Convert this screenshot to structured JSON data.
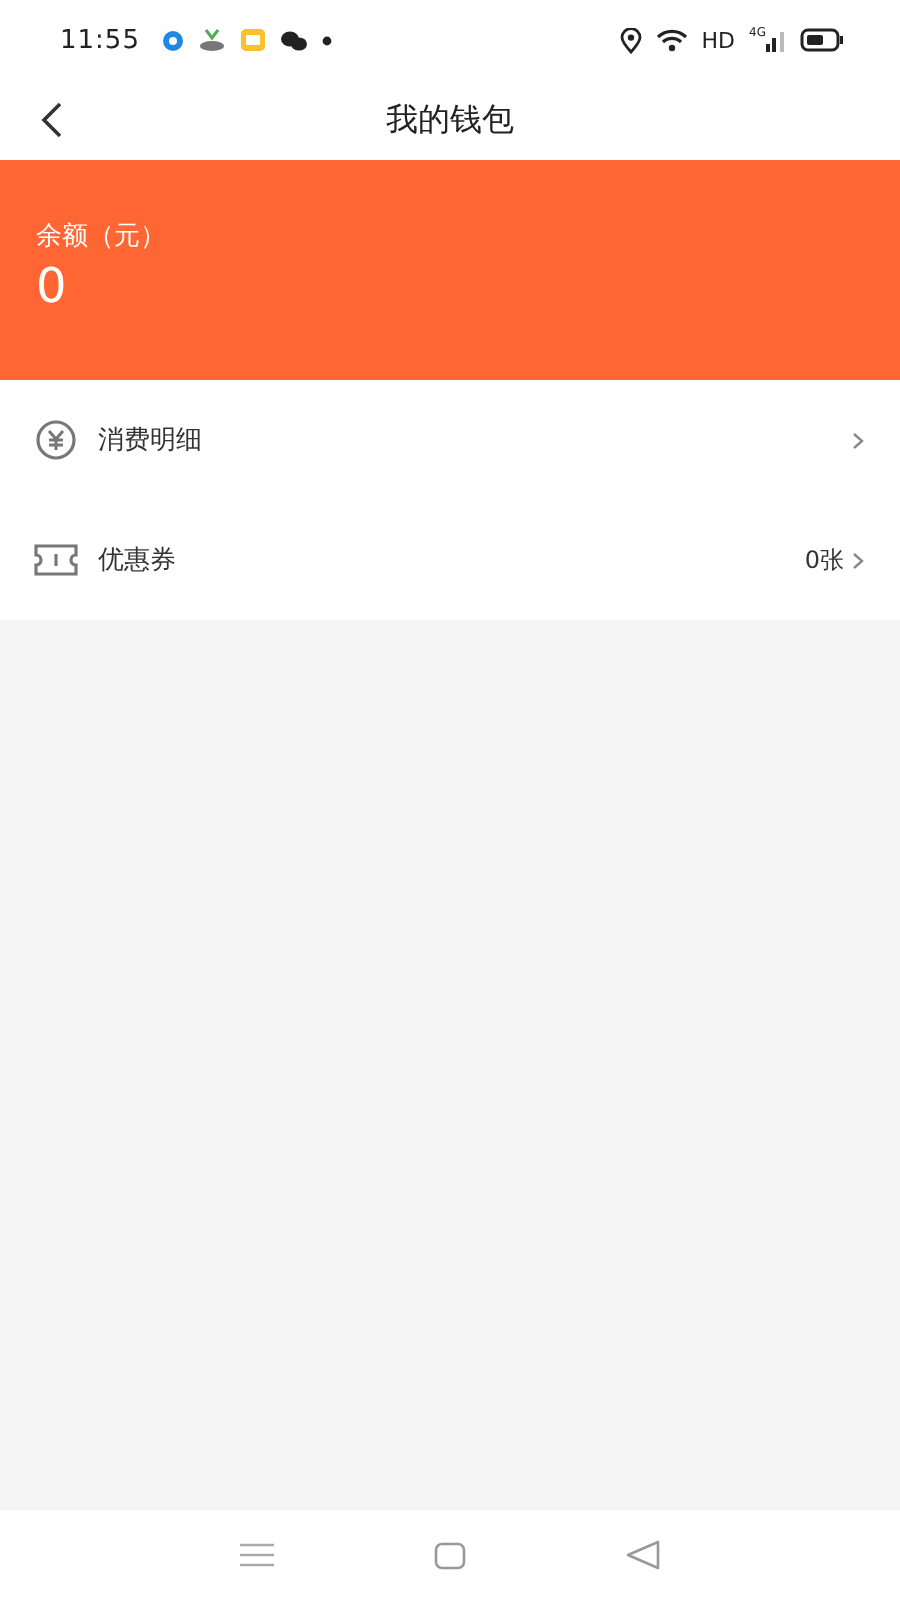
{
  "status_bar": {
    "time": "11:55",
    "network": "HD",
    "signal_label": "4G"
  },
  "header": {
    "title": "我的钱包"
  },
  "balance": {
    "label": "余额（元）",
    "amount": "0"
  },
  "menu": [
    {
      "kind": "spending",
      "label": "消费明细"
    },
    {
      "kind": "coupon",
      "label": "优惠券",
      "value": "0张"
    }
  ]
}
